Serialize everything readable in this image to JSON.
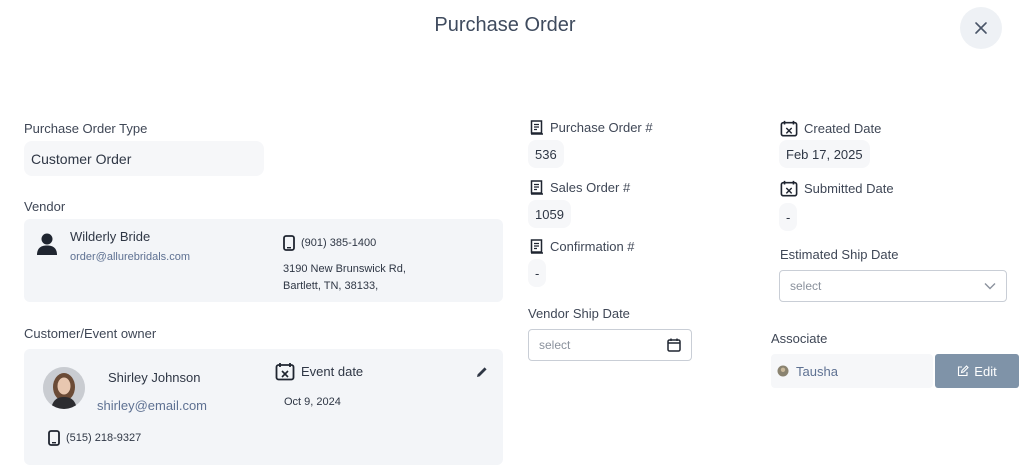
{
  "header": {
    "title": "Purchase Order"
  },
  "po_type": {
    "label": "Purchase Order Type",
    "value": "Customer Order"
  },
  "vendor": {
    "label": "Vendor",
    "name": "Wilderly Bride",
    "email": "order@allurebridals.com",
    "phone": "(901) 385-1400",
    "address_line1": "3190 New Brunswick Rd,",
    "address_line2": "Bartlett, TN, 38133,"
  },
  "customer": {
    "label": "Customer/Event owner",
    "name": "Shirley Johnson",
    "email": "shirley@email.com",
    "phone": "(515) 218-9327",
    "event_label": "Event date",
    "event_date": "Oct 9, 2024"
  },
  "order_numbers": {
    "po_label": "Purchase Order #",
    "po_value": "536",
    "so_label": "Sales Order #",
    "so_value": "1059",
    "conf_label": "Confirmation #",
    "conf_value": "-"
  },
  "vendor_ship": {
    "label": "Vendor Ship Date",
    "placeholder": "select"
  },
  "dates": {
    "created_label": "Created Date",
    "created_value": "Feb 17, 2025",
    "submitted_label": "Submitted Date",
    "submitted_value": "-",
    "est_ship_label": "Estimated Ship Date",
    "est_ship_placeholder": "select"
  },
  "associate": {
    "label": "Associate",
    "name": "Tausha",
    "edit_label": "Edit"
  },
  "colors": {
    "link": "#5e7192",
    "button": "#7f93a8",
    "card": "#f3f5f8"
  }
}
